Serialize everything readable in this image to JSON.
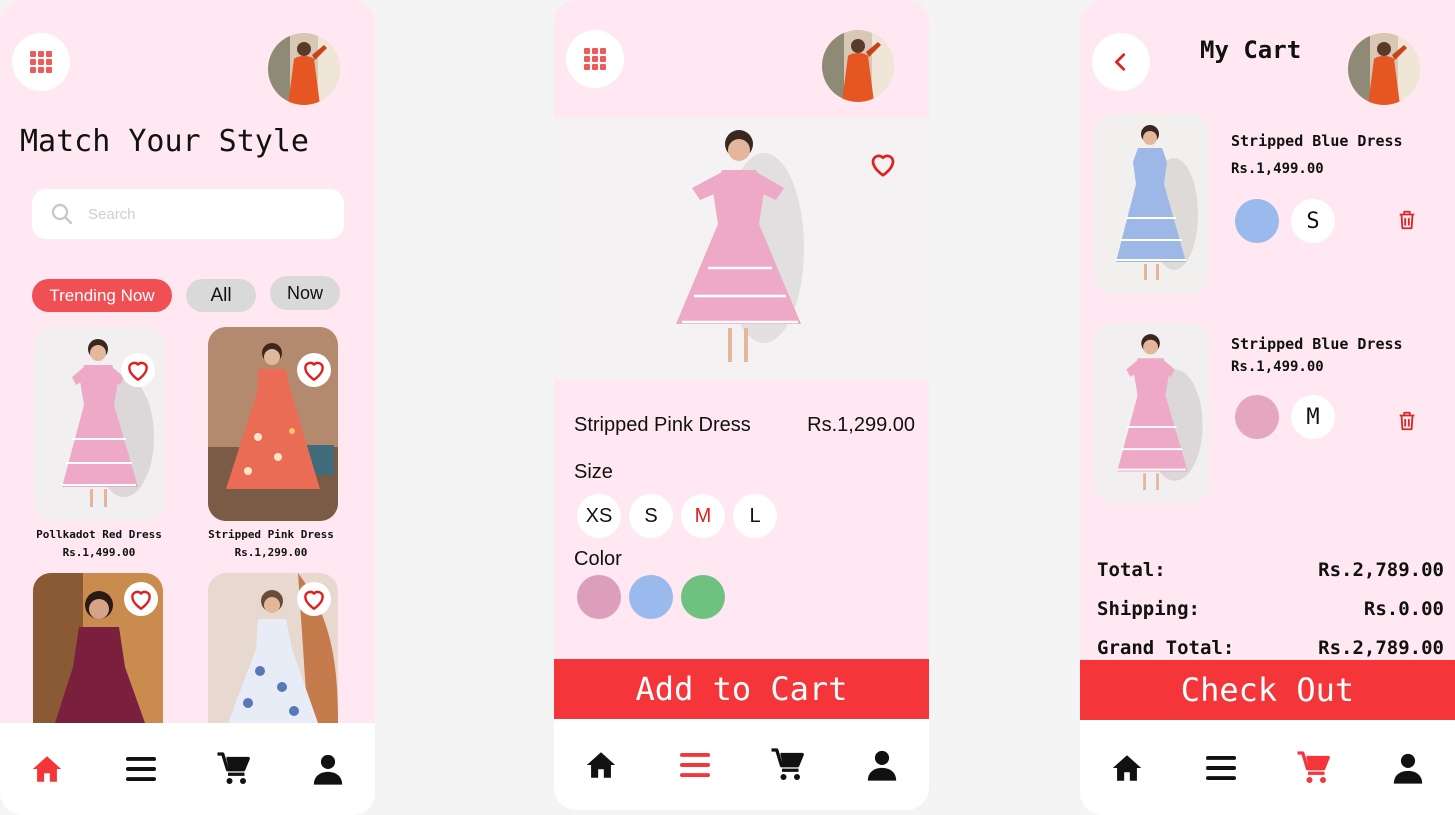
{
  "colors": {
    "bg": "#ffe8f1",
    "accent": "#f4363b",
    "pink": "#dd9ebb",
    "blue": "#9ab9ec",
    "green": "#6fc17f"
  },
  "screen1": {
    "title": "Match Your Style",
    "search_placeholder": "Search",
    "chips": [
      "Trending Now",
      "All",
      "Now"
    ],
    "products": [
      {
        "name": "Pollkadot Red Dress",
        "price": "Rs.1,499.00"
      },
      {
        "name": "Stripped Pink Dress",
        "price": "Rs.1,299.00"
      },
      {
        "name": "",
        "price": ""
      },
      {
        "name": "",
        "price": ""
      }
    ]
  },
  "screen2": {
    "product_name": "Stripped Pink Dress",
    "price": "Rs.1,299.00",
    "size_label": "Size",
    "sizes": [
      "XS",
      "S",
      "M",
      "L"
    ],
    "selected_size": "M",
    "color_label": "Color",
    "button": "Add  to Cart"
  },
  "screen3": {
    "title": "My Cart",
    "items": [
      {
        "name": "Stripped Blue Dress",
        "price": "Rs.1,499.00",
        "size": "S",
        "color": "blue"
      },
      {
        "name": "Stripped Blue Dress",
        "price": "Rs.1,499.00",
        "size": "M",
        "color": "pink"
      }
    ],
    "summary": [
      {
        "label": "Total:",
        "value": "Rs.2,789.00"
      },
      {
        "label": "Shipping:",
        "value": "Rs.0.00"
      },
      {
        "label": "Grand Total:",
        "value": "Rs.2,789.00"
      }
    ],
    "button": "Check Out"
  },
  "nav_icons": [
    "home-icon",
    "menu-icon",
    "cart-icon",
    "profile-icon"
  ]
}
